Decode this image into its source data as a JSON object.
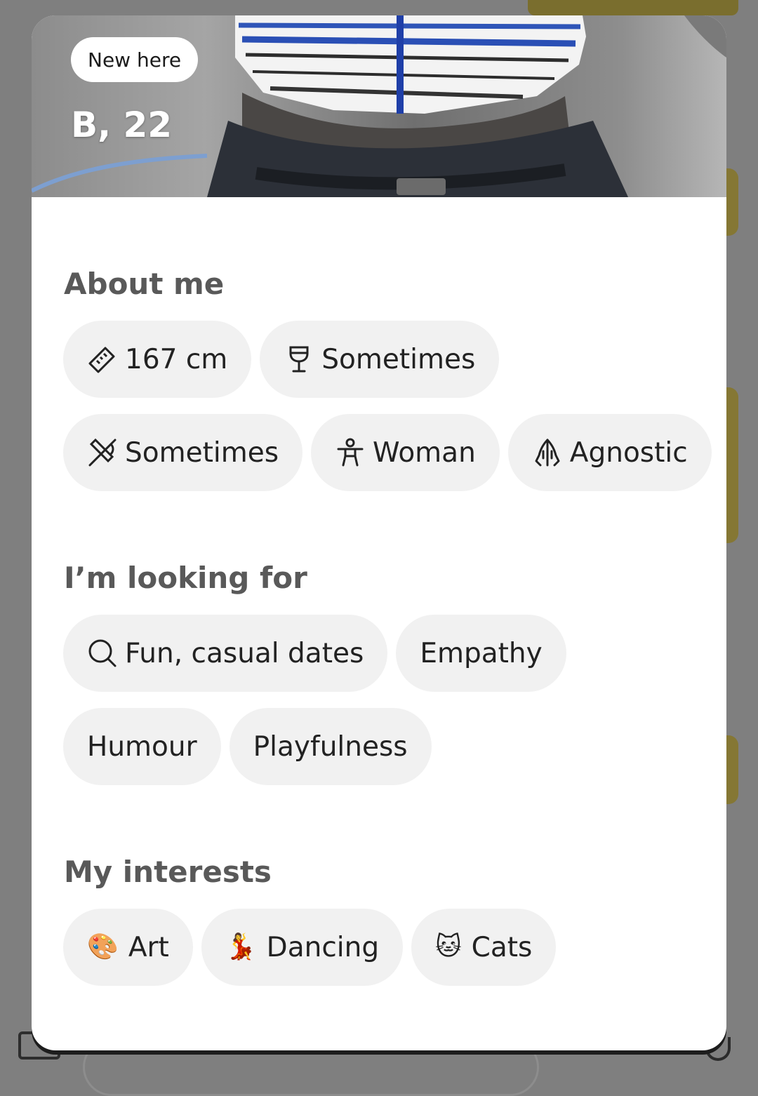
{
  "profile": {
    "badge": "New here",
    "name_age": "B, 22"
  },
  "sections": {
    "about": {
      "title": "About me",
      "chips": [
        {
          "icon": "ruler-icon",
          "label": "167 cm"
        },
        {
          "icon": "wine-glass-icon",
          "label": "Sometimes"
        },
        {
          "icon": "no-smoking-icon",
          "label": "Sometimes"
        },
        {
          "icon": "person-icon",
          "label": "Woman"
        },
        {
          "icon": "praying-hands-icon",
          "label": "Agnostic"
        }
      ]
    },
    "looking_for": {
      "title": "I’m looking for",
      "chips": [
        {
          "icon": "search-icon",
          "label": "Fun, casual dates"
        },
        {
          "label": "Empathy"
        },
        {
          "label": "Humour"
        },
        {
          "label": "Playfulness"
        }
      ]
    },
    "interests": {
      "title": "My interests",
      "chips": [
        {
          "emoji": "🎨",
          "icon": "palette-emoji",
          "label": "Art"
        },
        {
          "emoji": "💃",
          "icon": "dancer-emoji",
          "label": "Dancing"
        },
        {
          "emoji": "🐱",
          "icon": "cat-emoji",
          "label": "Cats"
        }
      ]
    }
  },
  "colors": {
    "chip_bg": "#f1f1f1",
    "section_title": "#595959",
    "overlay": "#7f7f7f",
    "accent_tab": "#857734"
  }
}
